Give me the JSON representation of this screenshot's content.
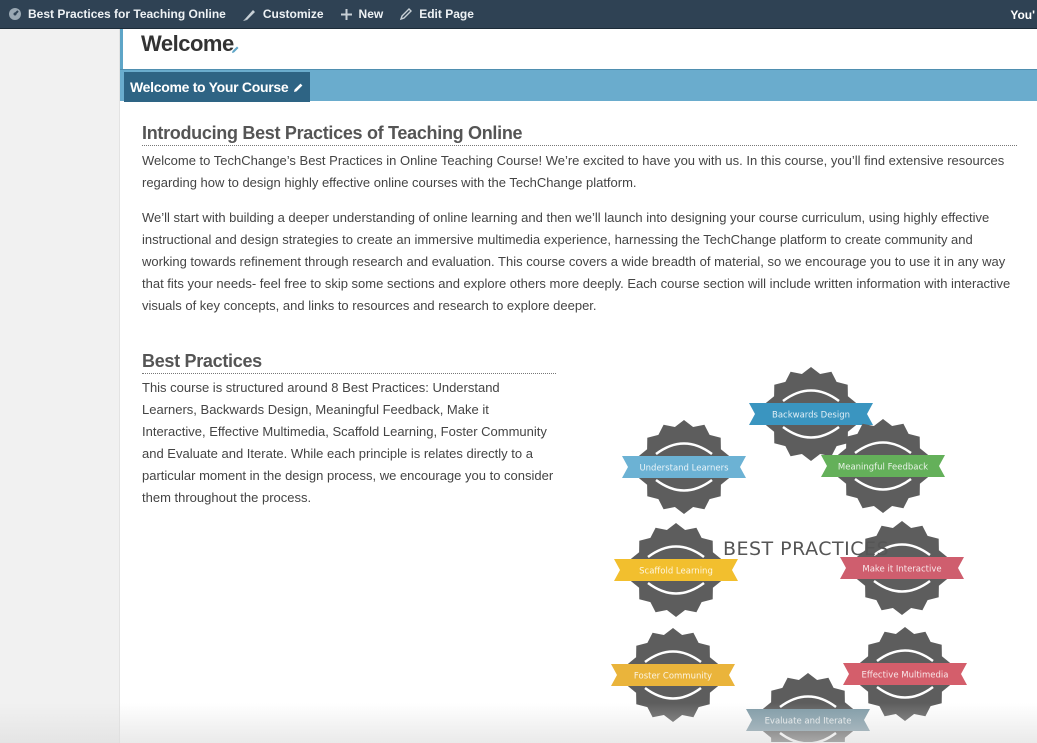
{
  "admin_bar": {
    "site_name": "Best Practices for Teaching Online",
    "customize": "Customize",
    "new": "New",
    "edit_page": "Edit Page",
    "user_greeting": "You'"
  },
  "page": {
    "title": "Welcome",
    "active_tab": "Welcome to Your Course"
  },
  "intro": {
    "heading": "Introducing Best Practices of Teaching Online",
    "paragraph1": "Welcome to TechChange’s Best Practices in Online Teaching Course! We’re excited to have you with us. In this course, you’ll find extensive resources regarding how to design highly effective online courses with the TechChange platform.",
    "paragraph2": "We’ll start with building a deeper understanding of online learning and then we’ll launch into designing your course curriculum, using highly effective instructional and design strategies to create an immersive multimedia experience, harnessing the TechChange platform to create community and working towards refinement through research and evaluation. This course covers a wide breadth of material, so we encourage you to use it in any way that fits your needs- feel free to skip some sections and explore others more deeply. Each course section will include written information with interactive visuals of key concepts, and links to resources and research to explore deeper."
  },
  "best_practices": {
    "heading": "Best Practices",
    "paragraph": "This course is structured around 8 Best Practices: Understand Learners, Backwards Design, Meaningful Feedback, Make it Interactive, Effective Multimedia, Scaffold Learning, Foster Community and Evaluate and Iterate. While each principle is relates directly to a particular moment in the design process, we encourage you to consider them throughout the process."
  },
  "diagram": {
    "center_label": "BEST PRACTICES",
    "badges": [
      {
        "label": "Backwards Design",
        "color": "#3a95c0"
      },
      {
        "label": "Meaningful Feedback",
        "color": "#64b05a"
      },
      {
        "label": "Make it Interactive",
        "color": "#cf5e6e"
      },
      {
        "label": "Effective Multimedia",
        "color": "#d45e6b"
      },
      {
        "label": "Evaluate and Iterate",
        "color": "#7e9aa6"
      },
      {
        "label": "Foster Community",
        "color": "#eab43b"
      },
      {
        "label": "Scaffold Learning",
        "color": "#f2bf2e"
      },
      {
        "label": "Understand Learners",
        "color": "#6cb2d4"
      }
    ]
  },
  "colors": {
    "admin_bar": "#2f4254",
    "tab_strip": "#6aaccd",
    "active_tab": "#2e6484",
    "badge_gray": "#5d5d5d"
  }
}
